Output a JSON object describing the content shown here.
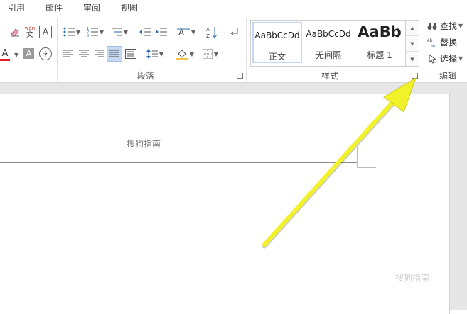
{
  "menu": {
    "tabs": [
      "引用",
      "邮件",
      "审阅",
      "视图"
    ]
  },
  "ribbon": {
    "groups": {
      "paragraph": "段落",
      "styles": "样式",
      "editing": "编辑"
    },
    "styles_gallery": [
      {
        "sample": "AaBbCcDd",
        "name": "正文"
      },
      {
        "sample": "AaBbCcDd",
        "name": "无间隔"
      },
      {
        "sample": "AaBb",
        "name": "标题 1"
      }
    ],
    "editing": {
      "find": "查找",
      "replace": "替换",
      "select": "选择"
    },
    "font_buttons": {
      "phonetic": "wén",
      "phonetic_char": "文",
      "border_char": "A",
      "color_char": "A",
      "shade_char": "A",
      "encircle_char": "字"
    }
  },
  "document": {
    "header_text": "搜狗指南"
  },
  "watermark": "搜狗指南"
}
